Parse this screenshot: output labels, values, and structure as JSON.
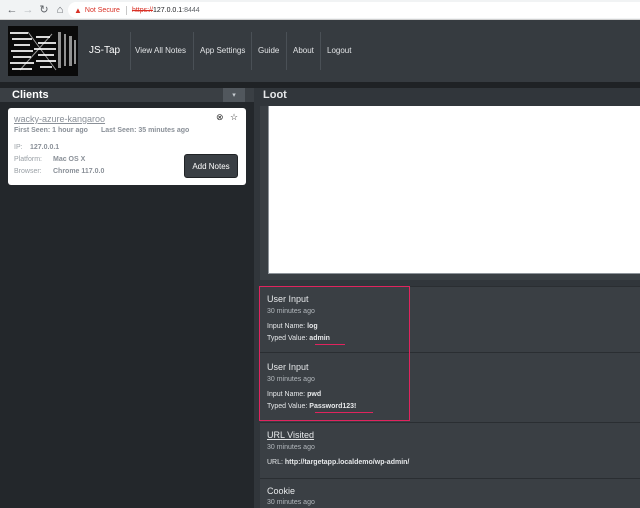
{
  "browser": {
    "security_label": "Not Secure",
    "url_scheme": "https://",
    "url_host": "127.0.0.1",
    "url_port": ":8444"
  },
  "navbar": {
    "brand": "JS-Tap",
    "links": [
      "View All Notes",
      "App Settings",
      "Guide",
      "About",
      "Logout"
    ]
  },
  "clients_panel": {
    "title": "Clients",
    "collapse_glyph": "▾",
    "client": {
      "name": "wacky-azure-kangaroo",
      "first_seen_label": "First Seen: 1 hour ago",
      "last_seen_label": "Last Seen: 35 minutes ago",
      "ip_label": "IP:",
      "ip": "127.0.0.1",
      "platform_label": "Platform:",
      "platform": "Mac OS X",
      "browser_label": "Browser:",
      "browser": "Chrome 117.0.0",
      "add_notes": "Add Notes"
    }
  },
  "loot_panel": {
    "title": "Loot",
    "items": [
      {
        "type": "User Input",
        "time": "30 minutes ago",
        "field1_label": "Input Name:",
        "field1_value": "log",
        "field2_label": "Typed Value:",
        "field2_value": "admin"
      },
      {
        "type": "User Input",
        "time": "30 minutes ago",
        "field1_label": "Input Name:",
        "field1_value": "pwd",
        "field2_label": "Typed Value:",
        "field2_value": "Password123!"
      },
      {
        "type": "URL Visited",
        "time": "30 minutes ago",
        "field1_label": "URL:",
        "field1_value": "http://targetapp.localdemo/wp-admin/"
      },
      {
        "type": "Cookie",
        "time": "30 minutes ago"
      }
    ]
  },
  "colors": {
    "highlight": "#e0245e",
    "navbar_bg": "#363b40",
    "loot_card_bg": "#3a3f44"
  }
}
